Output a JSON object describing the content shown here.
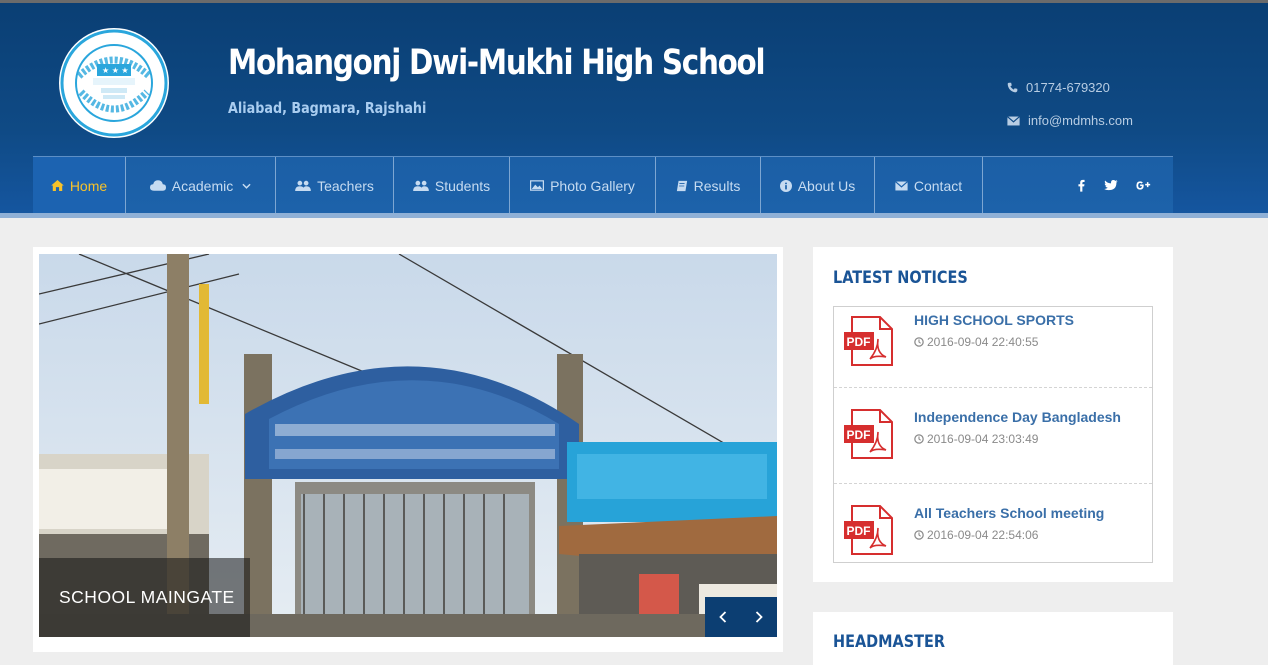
{
  "header": {
    "school_name": "Mohangonj Dwi-Mukhi High School",
    "address": "Aliabad, Bagmara, Rajshahi",
    "phone": "01774-679320",
    "email": "info@mdmhs.com"
  },
  "nav": {
    "items": [
      {
        "label": "Home",
        "icon": "home-icon",
        "active": true
      },
      {
        "label": "Academic",
        "icon": "cloud-icon",
        "dropdown": true
      },
      {
        "label": "Teachers",
        "icon": "users-icon"
      },
      {
        "label": "Students",
        "icon": "users-icon"
      },
      {
        "label": "Photo Gallery",
        "icon": "picture-icon"
      },
      {
        "label": "Results",
        "icon": "book-icon"
      },
      {
        "label": "About Us",
        "icon": "info-icon"
      },
      {
        "label": "Contact",
        "icon": "envelope-icon"
      }
    ],
    "social": [
      "facebook-icon",
      "twitter-icon",
      "google-plus-icon"
    ]
  },
  "slider": {
    "caption": "SCHOOL MAINGATE",
    "prev_icon": "chevron-left-icon",
    "next_icon": "chevron-right-icon"
  },
  "notices": {
    "title": "LATEST NOTICES",
    "items": [
      {
        "title": "HIGH SCHOOL SPORTS",
        "date": "2016-09-04 22:40:55"
      },
      {
        "title": "Independence Day Bangladesh",
        "date": "2016-09-04 23:03:49"
      },
      {
        "title": "All Teachers School meeting",
        "date": "2016-09-04 22:54:06"
      }
    ]
  },
  "headmaster": {
    "title": "HEADMASTER"
  },
  "colors": {
    "header_bg": "#0f4a85",
    "nav_bg": "#1d62aa",
    "active_nav": "#f7c22a",
    "notice_link": "#3a6fa8",
    "heading": "#1a5496"
  }
}
